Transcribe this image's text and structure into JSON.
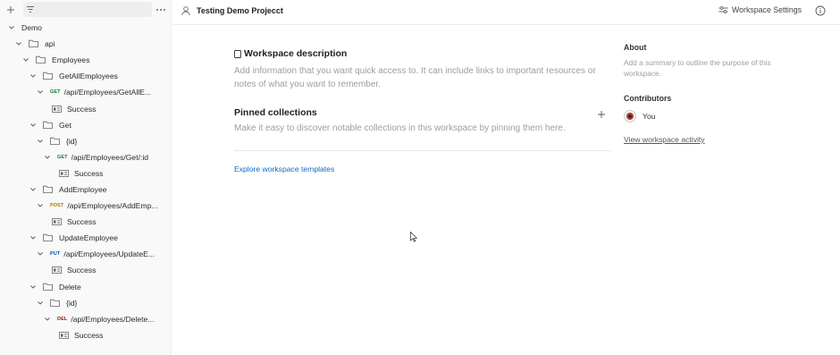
{
  "sidebar": {
    "tree": [
      {
        "depth": 0,
        "kind": "root",
        "label": "Demo"
      },
      {
        "depth": 1,
        "kind": "folder",
        "label": "api"
      },
      {
        "depth": 2,
        "kind": "folder",
        "label": "Employees"
      },
      {
        "depth": 3,
        "kind": "folder",
        "label": "GetAllEmployees"
      },
      {
        "depth": 4,
        "kind": "request",
        "method": "GET",
        "label": "/api/Employees/GetAllE..."
      },
      {
        "depth": 5,
        "kind": "example",
        "label": "Success"
      },
      {
        "depth": 3,
        "kind": "folder",
        "label": "Get"
      },
      {
        "depth": 4,
        "kind": "folder",
        "label": "{id}"
      },
      {
        "depth": 5,
        "kind": "request",
        "method": "GET",
        "label": "/api/Employees/Get/:id"
      },
      {
        "depth": 6,
        "kind": "example",
        "label": "Success"
      },
      {
        "depth": 3,
        "kind": "folder",
        "label": "AddEmployee"
      },
      {
        "depth": 4,
        "kind": "request",
        "method": "POST",
        "label": "/api/Employees/AddEmp..."
      },
      {
        "depth": 5,
        "kind": "example",
        "label": "Success"
      },
      {
        "depth": 3,
        "kind": "folder",
        "label": "UpdateEmployee"
      },
      {
        "depth": 4,
        "kind": "request",
        "method": "PUT",
        "label": "/api/Employees/UpdateE..."
      },
      {
        "depth": 5,
        "kind": "example",
        "label": "Success"
      },
      {
        "depth": 3,
        "kind": "folder",
        "label": "Delete"
      },
      {
        "depth": 4,
        "kind": "folder",
        "label": "{id}"
      },
      {
        "depth": 5,
        "kind": "request",
        "method": "DEL",
        "label": "/api/Employees/Delete..."
      },
      {
        "depth": 6,
        "kind": "example",
        "label": "Success"
      }
    ],
    "method_colors": {
      "GET": "#007f31",
      "POST": "#ad7a03",
      "PUT": "#0053b8",
      "DEL": "#8e1a10"
    }
  },
  "header": {
    "workspace_title": "Testing Demo Projecct",
    "settings_label": "Workspace Settings"
  },
  "main": {
    "description_heading": "Workspace description",
    "description_placeholder": "Add information that you want quick access to. It can include links to important resources or notes of what you want to remember.",
    "pinned_heading": "Pinned collections",
    "pinned_text": "Make it easy to discover notable collections in this workspace by pinning them here.",
    "explore_link": "Explore workspace templates"
  },
  "right_panel": {
    "about_heading": "About",
    "about_text": "Add a summary to outline the purpose of this workspace.",
    "contributors_heading": "Contributors",
    "contributor_name": "You",
    "activity_link": "View workspace activity"
  },
  "colors": {
    "link": "#0b6bcb",
    "muted": "#9e9e9e",
    "sidebar_bg": "#f9f9f9"
  }
}
